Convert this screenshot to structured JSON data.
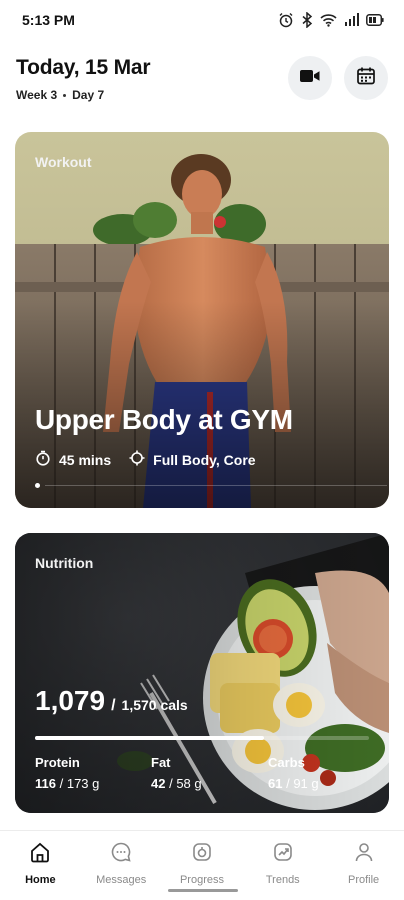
{
  "status": {
    "time": "5:13 PM"
  },
  "header": {
    "date": "Today, 15 Mar",
    "week": "Week 3",
    "day": "Day 7",
    "video_icon": "video-camera-icon",
    "calendar_icon": "calendar-icon"
  },
  "workout": {
    "label": "Workout",
    "title": "Upper Body at GYM",
    "duration": "45 mins",
    "focus": "Full Body, Core"
  },
  "nutrition": {
    "label": "Nutrition",
    "calories": "1,079",
    "sep": "/",
    "calories_total": "1,570 cals",
    "progress_fraction": 0.687,
    "macros": [
      {
        "name": "Protein",
        "value": "116",
        "total": "/ 173 g"
      },
      {
        "name": "Fat",
        "value": "42",
        "total": "/ 58 g"
      },
      {
        "name": "Carbs",
        "value": "61",
        "total": "/ 91 g"
      }
    ]
  },
  "nav": {
    "items": [
      {
        "label": "Home",
        "icon": "home-icon",
        "active": true
      },
      {
        "label": "Messages",
        "icon": "chat-icon",
        "active": false
      },
      {
        "label": "Progress",
        "icon": "progress-icon",
        "active": false
      },
      {
        "label": "Trends",
        "icon": "trends-icon",
        "active": false
      },
      {
        "label": "Profile",
        "icon": "profile-icon",
        "active": false
      }
    ]
  },
  "colors": {
    "accent": "#111111",
    "inactive": "#8a8a8a"
  }
}
